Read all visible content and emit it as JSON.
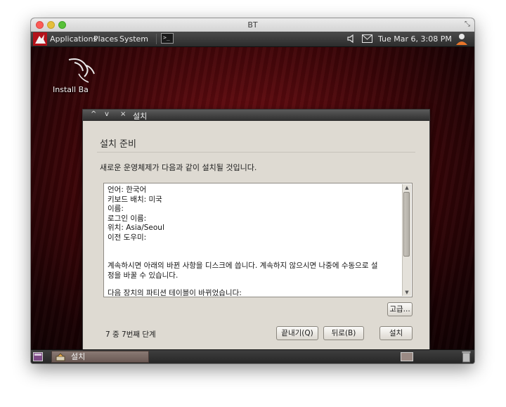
{
  "window": {
    "title": "BT"
  },
  "top_panel": {
    "menus": [
      "Applications",
      "Places",
      "System"
    ],
    "terminal_glyph": ">_",
    "clock": "Tue Mar  6,  3:08 PM"
  },
  "desktop": {
    "icon_label": "Install Ba"
  },
  "dialog": {
    "title": "설치",
    "controls": [
      "^",
      "v",
      "×"
    ],
    "heading": "설치 준비",
    "description": "새로운 운영체제가 다음과 같이 설치될 것입니다.",
    "summary_lines": [
      "언어: 한국어",
      "키보드 배치: 미국",
      "이름:",
      "로그인 이름:",
      "위치: Asia/Seoul",
      "이전 도우미:"
    ],
    "summary_paragraph_1": "계속하시면 아래의 바뀐 사항을 디스크에 씁니다. 계속하지 않으시면 나중에 수동으로 설",
    "summary_paragraph_2": "정을 바꿀 수 있습니다.",
    "summary_paragraph_3": "다음 장치의 파티션 테이블이 바뀌었습니다:",
    "advanced_button": "고급...",
    "step_label": "7 중 7번째 단계",
    "quit_button": "끝내기(Q)",
    "back_button": "뒤로(B)",
    "install_button": "설치"
  },
  "bottom_panel": {
    "task_label": "설치"
  },
  "colors": {
    "desktop_red": "#5a0a0e",
    "dialog_bg": "#dedad2",
    "panel_dark": "#2c2c2c"
  }
}
